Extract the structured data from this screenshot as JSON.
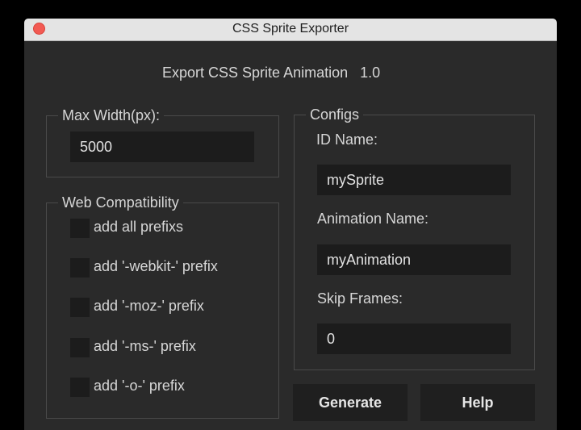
{
  "window": {
    "title": "CSS Sprite Exporter"
  },
  "header": {
    "text": "Export CSS Sprite Animation   1.0"
  },
  "max_width": {
    "label": "Max Width(px):",
    "value": "5000"
  },
  "web_compat": {
    "label": "Web Compatibility",
    "options": [
      {
        "label": "add all prefixs"
      },
      {
        "label": "add '-webkit-' prefix"
      },
      {
        "label": "add '-moz-' prefix"
      },
      {
        "label": "add '-ms-' prefix"
      },
      {
        "label": "add '-o-' prefix"
      }
    ]
  },
  "configs": {
    "label": "Configs",
    "id_name_label": "ID Name:",
    "id_name_value": "mySprite",
    "animation_name_label": "Animation Name:",
    "animation_name_value": "myAnimation",
    "skip_frames_label": "Skip Frames:",
    "skip_frames_value": "0"
  },
  "buttons": {
    "generate": "Generate",
    "help": "Help"
  }
}
